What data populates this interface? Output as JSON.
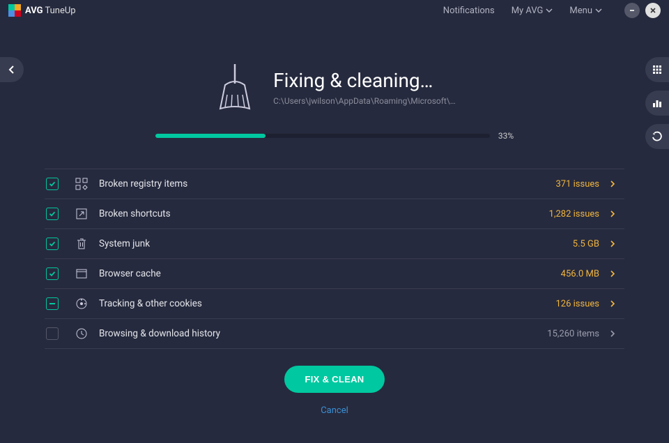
{
  "header": {
    "brand_bold": "AVG",
    "brand_text": "TuneUp",
    "notifications": "Notifications",
    "my_avg": "My AVG",
    "menu": "Menu"
  },
  "title": "Fixing & cleaning…",
  "path": "C:\\Users\\jwilson\\AppData\\Roaming\\Microsoft\\…",
  "progress_percent": 33,
  "progress_label": "33%",
  "items": [
    {
      "label": "Broken registry items",
      "value": "371 issues",
      "muted": false,
      "state": "checked"
    },
    {
      "label": "Broken shortcuts",
      "value": "1,282 issues",
      "muted": false,
      "state": "checked"
    },
    {
      "label": "System junk",
      "value": "5.5 GB",
      "muted": false,
      "state": "checked"
    },
    {
      "label": "Browser cache",
      "value": "456.0 MB",
      "muted": false,
      "state": "checked"
    },
    {
      "label": "Tracking & other cookies",
      "value": "126 issues",
      "muted": false,
      "state": "indeterminate"
    },
    {
      "label": "Browsing & download history",
      "value": "15,260 items",
      "muted": true,
      "state": "unchecked"
    }
  ],
  "primary_button": "FIX & CLEAN",
  "cancel": "Cancel"
}
